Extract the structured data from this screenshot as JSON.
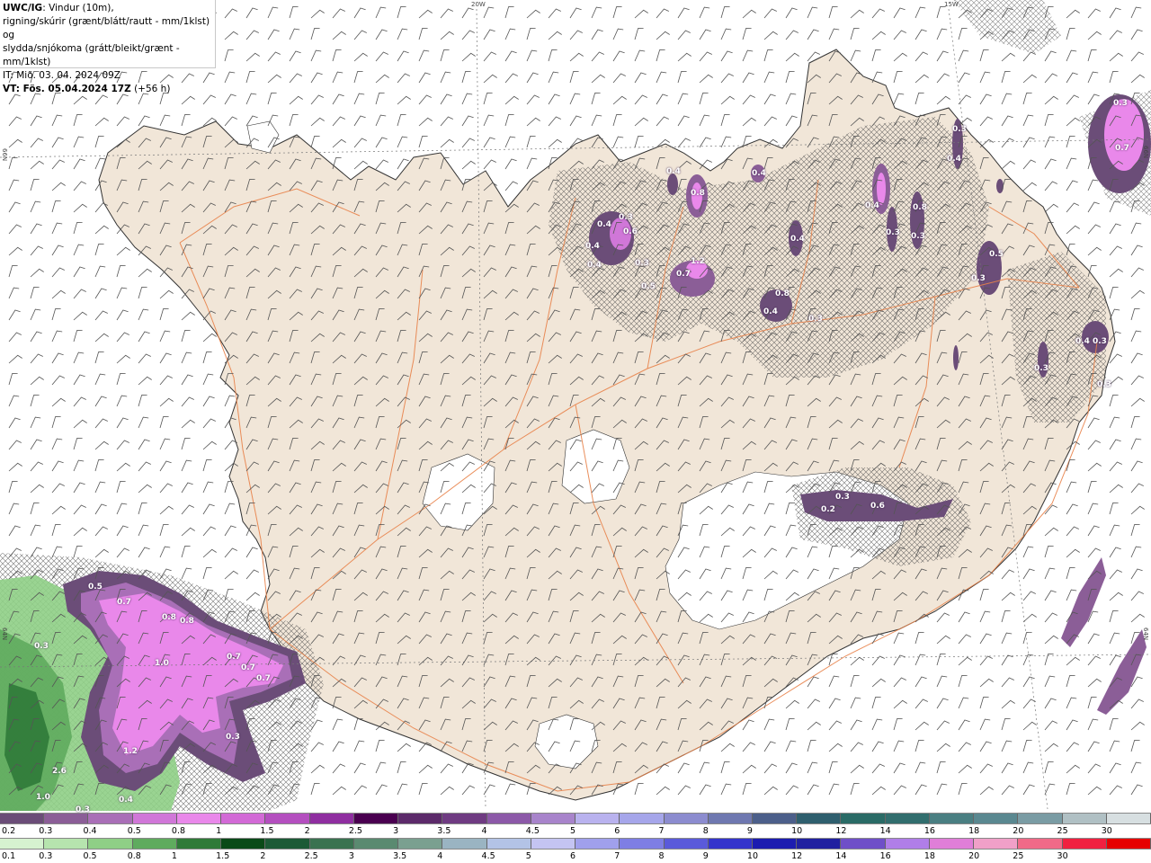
{
  "header": {
    "line1_bold": "UWC/IG",
    "line1_rest": ": Vindur (10m),",
    "line2": "rigning/skúrir (grænt/blátt/rautt - mm/1klst) og",
    "line3": "slydda/snjókoma (grátt/bleikt/grænt - mm/1klst)",
    "line4": "IT: Mið. 03. 04. 2024 09Z",
    "line5_bold": "VT: Fös. 05.04.2024 17Z",
    "line5_rest": " (+56 h)"
  },
  "coords": {
    "lon_20w": "20W",
    "lon_15w": "15W",
    "lat_66n_left": "66N",
    "lat_66n_right": "66N",
    "lat_64n_left": "64N",
    "lat_64n_right": "64N"
  },
  "map_values": [
    "0.5",
    "0.7",
    "0.8",
    "0.8",
    "0.3",
    "1.0",
    "0.7",
    "0.7",
    "0.7",
    "1.2",
    "0.3",
    "2.6",
    "1.0",
    "0.3",
    "0.4",
    "0.4",
    "0.3",
    "0.6",
    "0.4",
    "0.4",
    "0.3",
    "0.7",
    "1.2",
    "0.5",
    "0.8",
    "0.4",
    "0.4",
    "0.4",
    "0.8",
    "0.4",
    "0.3",
    "0.4",
    "0.3",
    "0.8",
    "0.3",
    "0.5",
    "0.3",
    "0.3",
    "0.4",
    "0.4",
    "0.3",
    "0.3",
    "0.3",
    "0.3",
    "0.7",
    "0.2",
    "0.3",
    "0.6"
  ],
  "colorbar_snow": {
    "ticks": [
      "0.2",
      "0.3",
      "0.4",
      "0.5",
      "0.8",
      "1",
      "1.5",
      "2",
      "2.5",
      "3",
      "3.5",
      "4",
      "4.5",
      "5",
      "6",
      "7",
      "8",
      "9",
      "10",
      "12",
      "14",
      "16",
      "18",
      "20",
      "25",
      "30"
    ],
    "colors": [
      "#6b4d78",
      "#8b5e97",
      "#a96fb7",
      "#d077d8",
      "#e988ea",
      "#d26ad6",
      "#b44fbf",
      "#8f2ea0",
      "#4a0050",
      "#5c2a6a",
      "#6f3b82",
      "#8c59a8",
      "#a884cb",
      "#b9b2ee",
      "#a6a6ea",
      "#8c8ccf",
      "#6f78b0",
      "#4c5f8a",
      "#2f5f6e",
      "#2a6b66",
      "#326e6e",
      "#4a7f82",
      "#5a8890",
      "#7a9ca4",
      "#b0c0c4",
      "#d7dfe1"
    ]
  },
  "colorbar_rain": {
    "ticks": [
      "0.1",
      "0.3",
      "0.5",
      "0.8",
      "1",
      "1.5",
      "2",
      "2.5",
      "3",
      "3.5",
      "4",
      "4.5",
      "5",
      "6",
      "7",
      "8",
      "9",
      "10",
      "12",
      "14",
      "16",
      "18",
      "20",
      "25",
      "30"
    ],
    "colors": [
      "#d6f2d0",
      "#b6e4ae",
      "#8fcf86",
      "#5fab5e",
      "#2f7a38",
      "#0a4a18",
      "#1c5a36",
      "#3a7250",
      "#5a8a70",
      "#7aa090",
      "#9ab4c2",
      "#b3c3e6",
      "#c4c4f2",
      "#a0a0ec",
      "#7e7ee4",
      "#5a5ada",
      "#3434cc",
      "#1c1cb0",
      "#2020a0",
      "#6f4fc8",
      "#b07ee8",
      "#e07ed8",
      "#f0a0c8",
      "#f06a88",
      "#f02040",
      "#e60000"
    ]
  }
}
